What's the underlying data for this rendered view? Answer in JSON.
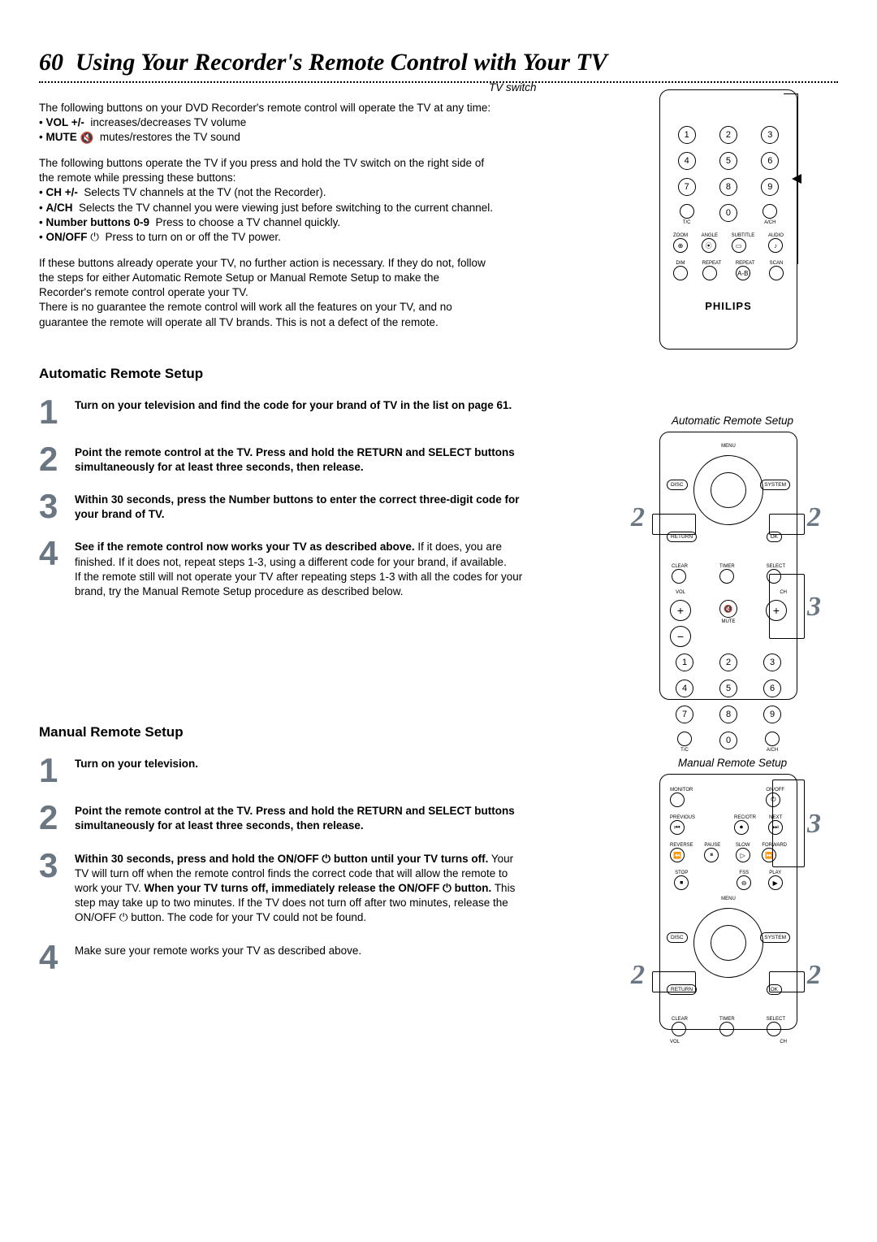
{
  "page_number": "60",
  "page_title": "Using Your Recorder's Remote Control with Your TV",
  "intro": {
    "p1": "The following buttons on your DVD Recorder's remote control will operate the TV at any time:",
    "vol_label": "VOL +/-",
    "vol_desc": "increases/decreases TV volume",
    "mute_label": "MUTE",
    "mute_desc": "mutes/restores the TV sound",
    "p2": "The following buttons operate the TV if you press and hold the TV switch on the right side of the remote while pressing these buttons:",
    "ch_label": "CH +/-",
    "ch_desc": "Selects TV channels at the TV (not the Recorder).",
    "ach_label": "A/CH",
    "ach_desc": "Selects the TV channel you were viewing just before switching to the current channel.",
    "num_label": "Number buttons 0-9",
    "num_desc": "Press to choose a TV channel quickly.",
    "onoff_label": "ON/OFF",
    "onoff_desc": "Press to turn on or off the TV power.",
    "p3": "If these buttons already operate your TV, no further action is necessary. If they do not, follow the steps for either Automatic Remote Setup or Manual Remote Setup to make the Recorder's remote control operate your TV.",
    "p4": "There is no guarantee the remote control will work all the features on your TV, and no guarantee the remote will operate all TV brands. This is not a defect of the remote."
  },
  "auto": {
    "heading": "Automatic Remote Setup",
    "caption": "Automatic Remote Setup",
    "s1": "Turn on your television and find the code for your brand of TV in the list on page 61.",
    "s2": "Point the remote control at the TV. Press and hold the RETURN and SELECT buttons simultaneously for at least three seconds, then release.",
    "s3": "Within 30 seconds, press the Number buttons to enter the correct three-digit code for your brand of TV.",
    "s4a": "See if the remote control now works your TV as described above.",
    "s4b": "If it does, you are finished. If it does not, repeat steps 1-3, using a different code for your brand, if available.",
    "s4c": "If the remote still will not operate your TV after repeating steps 1-3 with all the codes for your brand, try the Manual Remote Setup procedure as described below."
  },
  "manual": {
    "heading": "Manual Remote Setup",
    "caption": "Manual Remote Setup",
    "s1": "Turn on your television.",
    "s2": "Point the remote control at the TV. Press and hold the RETURN and SELECT buttons simultaneously for at least three seconds, then release.",
    "s3a": "Within 30 seconds, press and hold the ON/OFF ",
    "s3b": " button until your TV turns off.",
    "s3c": "Your TV will turn off when the remote control finds the correct code that will allow the remote to work your TV. ",
    "s3d": "When your TV turns off, immediately release the ON/OFF ",
    "s3e": " button.",
    "s3f": "This step may take up to two minutes. If the TV does not turn off after two minutes, release the ON/OFF ",
    "s3g": " button. The code for your TV could not be found.",
    "s4": "Make sure your remote works your TV as described above."
  },
  "diagram": {
    "tv_switch": "TV switch",
    "philips": "PHILIPS",
    "numbers": [
      "1",
      "2",
      "3",
      "4",
      "5",
      "6",
      "7",
      "8",
      "9",
      "0"
    ],
    "labels": {
      "tc": "T/C",
      "ach": "A/CH",
      "zoom": "ZOOM",
      "angle": "ANGLE",
      "subtitle": "SUBTITLE",
      "audio": "AUDIO",
      "dim": "DIM",
      "repeat": "REPEAT",
      "repeat_ab": "REPEAT",
      "ab": "A-B",
      "scan": "SCAN",
      "disc": "DISC",
      "system": "SYSTEM",
      "menu": "MENU",
      "return": "RETURN",
      "ok": "OK",
      "clear": "CLEAR",
      "timer": "TIMER",
      "select": "SELECT",
      "vol": "VOL",
      "ch": "CH",
      "mute": "MUTE",
      "monitor": "MONITOR",
      "onoff": "ON/OFF",
      "previous": "PREVIOUS",
      "recotr": "REC/OTR",
      "next": "NEXT",
      "reverse": "REVERSE",
      "pause": "PAUSE",
      "slow": "SLOW",
      "forward": "FORWARD",
      "stop": "STOP",
      "fss": "FSS",
      "play": "PLAY"
    }
  },
  "icons": {
    "mute": "🔇",
    "power": "⏻",
    "plus": "+",
    "minus": "−"
  }
}
